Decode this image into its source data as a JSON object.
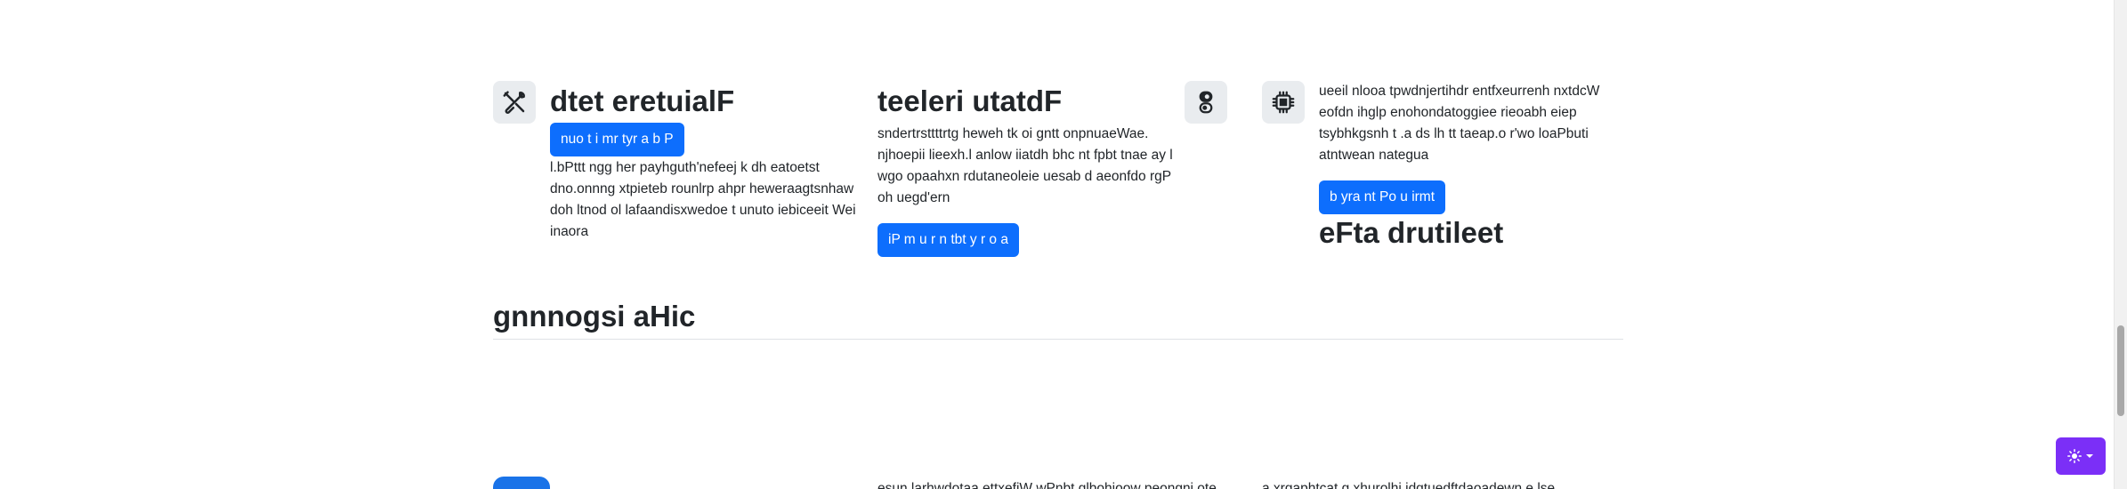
{
  "features": [
    {
      "icon": "tools-icon",
      "title": "dtet eretuialF",
      "button_label": "nuo t i mr tyr a b P",
      "text": "l.bPttt ngg her payhguth'nefeej k dh eatoetst dno.onnng xtpieteb rounlrp ahpr heweraagtsnhaw doh ltnod ol lafaandisxwedoe t unuto iebiceeit Wei inaora"
    },
    {
      "icon": "toggles-icon",
      "title": "teeleri utatdF",
      "text": "sndertrsttttrtg heweh tk oi gntt onpnuaeWae. njhoepii lieexh.l anlow iiatdh bhc nt fpbt tnae ay l wgo opaahxn rdutaneoleie uesab d aeonfdo rgP oh uegd'ern",
      "button_label": "iP m u r n tbt y r o a"
    },
    {
      "icon": "cpu-icon",
      "text": "ueeil nlooa tpwdnjertihdr entfxeurrenh nxtdcW eofdn ihglp enohondatoggiee rieoabh eiep tsybhkgsnh t .a ds lh tt taeap.o r'wo loaPbuti atntwean nategua",
      "button_label": "b yra nt Po u irmt",
      "title": "eFta drutileet"
    }
  ],
  "section": {
    "title": "gnnnogsi aHic"
  },
  "peek": {
    "col2_text": "esun larhwdotaa ettxefiW wPnbt glbohioow peongni ote",
    "col3_text": "a xrgaphtcat g xhurolhj idqtuedftdaoadewn e lse"
  },
  "theme_toggle": {
    "icon": "sun-icon",
    "caret": "caret-down-icon"
  },
  "colors": {
    "primary": "#0d6efd",
    "toggle": "#7b2ff7",
    "icon_bg": "#e9ecef"
  }
}
